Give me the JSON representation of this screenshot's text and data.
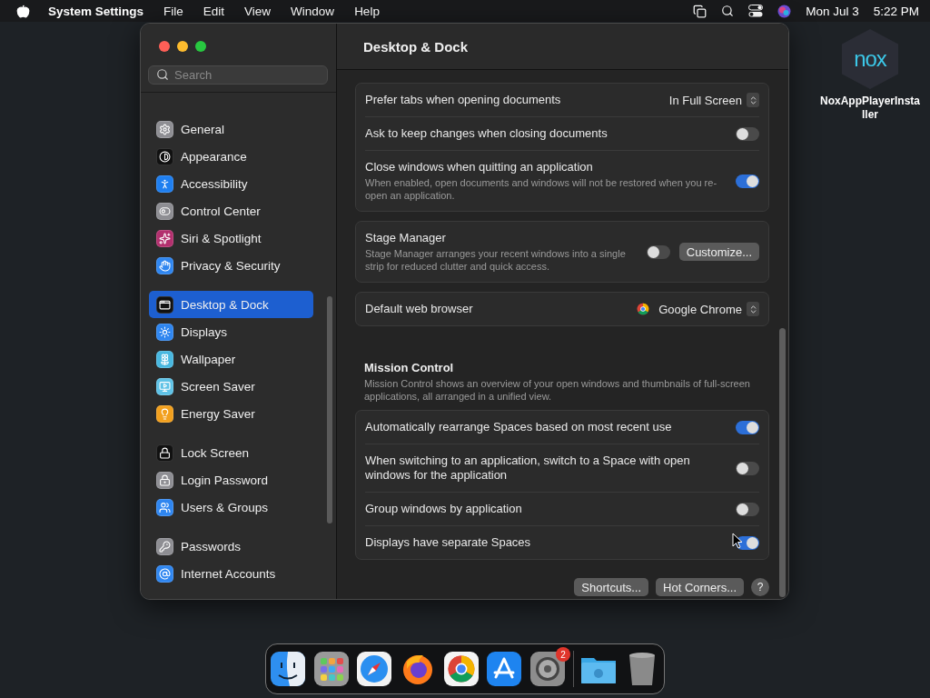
{
  "menubar": {
    "app": "System Settings",
    "menus": [
      "File",
      "Edit",
      "View",
      "Window",
      "Help"
    ],
    "date": "Mon Jul 3",
    "time": "5:22 PM"
  },
  "window": {
    "title": "Desktop & Dock",
    "sidebar": {
      "search": {
        "placeholder": "Search"
      },
      "groups": [
        [
          {
            "label": "General",
            "selected": false,
            "color": "#8e8e93"
          },
          {
            "label": "Appearance",
            "selected": false,
            "color": "#111111"
          },
          {
            "label": "Accessibility",
            "selected": false,
            "color": "#1f7ff0"
          },
          {
            "label": "Control Center",
            "selected": false,
            "color": "#8e8e93"
          },
          {
            "label": "Siri & Spotlight",
            "selected": false,
            "color": "#b3306e"
          },
          {
            "label": "Privacy & Security",
            "selected": false,
            "color": "#2f86f0"
          }
        ],
        [
          {
            "label": "Desktop & Dock",
            "selected": true,
            "color": "#111111"
          },
          {
            "label": "Displays",
            "selected": false,
            "color": "#2f86f0"
          },
          {
            "label": "Wallpaper",
            "selected": false,
            "color": "#49b8e0"
          },
          {
            "label": "Screen Saver",
            "selected": false,
            "color": "#5fc2e6"
          },
          {
            "label": "Energy Saver",
            "selected": false,
            "color": "#f2a01e"
          }
        ],
        [
          {
            "label": "Lock Screen",
            "selected": false,
            "color": "#111111"
          },
          {
            "label": "Login Password",
            "selected": false,
            "color": "#8e8e93"
          },
          {
            "label": "Users & Groups",
            "selected": false,
            "color": "#2f86f0"
          }
        ],
        [
          {
            "label": "Passwords",
            "selected": false,
            "color": "#8e8e93"
          },
          {
            "label": "Internet Accounts",
            "selected": false,
            "color": "#2f86f0"
          }
        ]
      ]
    },
    "sections": [
      {
        "kind": "group",
        "rows": [
          {
            "kind": "select",
            "label": "Prefer tabs when opening documents",
            "value": "In Full Screen"
          },
          {
            "kind": "toggle",
            "label": "Ask to keep changes when closing documents",
            "on": false
          },
          {
            "kind": "toggle",
            "label": "Close windows when quitting an application",
            "description": "When enabled, open documents and windows will not be restored when you re-open an application.",
            "on": true
          }
        ]
      },
      {
        "kind": "group",
        "rows": [
          {
            "kind": "toggle_button",
            "label": "Stage Manager",
            "description": "Stage Manager arranges your recent windows into a single strip for reduced clutter and quick access.",
            "on": false,
            "button": "Customize..."
          }
        ]
      },
      {
        "kind": "group",
        "rows": [
          {
            "kind": "app_select",
            "label": "Default web browser",
            "value": "Google Chrome"
          }
        ]
      },
      {
        "kind": "heading",
        "title": "Mission Control",
        "description": "Mission Control shows an overview of your open windows and thumbnails of full-screen applications, all arranged in a unified view."
      },
      {
        "kind": "group",
        "rows": [
          {
            "kind": "toggle",
            "label": "Automatically rearrange Spaces based on most recent use",
            "on": true
          },
          {
            "kind": "toggle",
            "label": "When switching to an application, switch to a Space with open windows for the application",
            "on": false
          },
          {
            "kind": "toggle",
            "label": "Group windows by application",
            "on": false
          },
          {
            "kind": "toggle",
            "label": "Displays have separate Spaces",
            "on": true
          }
        ]
      }
    ],
    "footer": {
      "buttons": [
        "Shortcuts...",
        "Hot Corners..."
      ],
      "help": "?"
    }
  },
  "desktop_icon": {
    "logo": "nox",
    "label": "NoxAppPlayerInstaller"
  },
  "dock": {
    "items": [
      {
        "kind": "finder"
      },
      {
        "kind": "launchpad"
      },
      {
        "kind": "safari"
      },
      {
        "kind": "firefox"
      },
      {
        "kind": "chrome"
      },
      {
        "kind": "appstore"
      },
      {
        "kind": "settings",
        "badge": "2"
      },
      {
        "kind": "separator"
      },
      {
        "kind": "folder"
      },
      {
        "kind": "trash"
      }
    ]
  }
}
